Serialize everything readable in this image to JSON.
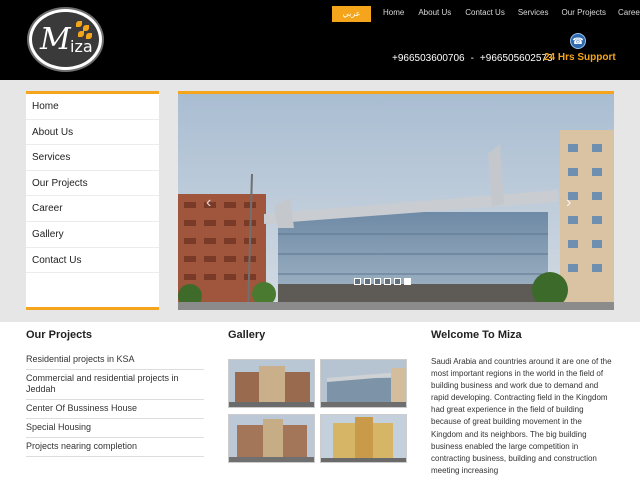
{
  "header": {
    "logo_text_m": "M",
    "logo_text_rest": "iza",
    "lang_button": "عربي",
    "nav": [
      "Home",
      "About Us",
      "Contact Us",
      "Services",
      "Our Projects",
      "Career"
    ],
    "phone1": "+966503600706",
    "phone_separator": "-",
    "phone2": "+966505602573",
    "support_label": "24 Hrs Support"
  },
  "sidebar": {
    "items": [
      "Home",
      "About Us",
      "Services",
      "Our Projects",
      "Career",
      "Gallery",
      "Contact Us"
    ]
  },
  "slider": {
    "prev_arrow": "‹",
    "next_arrow": "›",
    "slide_count": 6,
    "active_slide": 6
  },
  "projects": {
    "title": "Our Projects",
    "items": [
      "Residential projects in KSA",
      "Commercial and residential projects in Jeddah",
      "Center Of Bussiness House",
      "Special Housing",
      "Projects nearing completion"
    ]
  },
  "gallery": {
    "title": "Gallery"
  },
  "welcome": {
    "title": "Welcome To Miza",
    "text": "Saudi Arabia and countries around it are one of the most important regions in the world in the field of building business and work due to demand and rapid developing. Contracting field in the Kingdom had great experience in the field of building because of great building movement in the Kingdom and its neighbors. The big building business enabled the large competition in contracting business, building and construction meeting increasing"
  },
  "colors": {
    "accent": "#f5a51b",
    "header_bg": "#000000",
    "band_bg": "#e6e6e6"
  },
  "icons": [
    "support-globe-icon",
    "leaf-icon",
    "chevron-left-icon",
    "chevron-right-icon"
  ]
}
